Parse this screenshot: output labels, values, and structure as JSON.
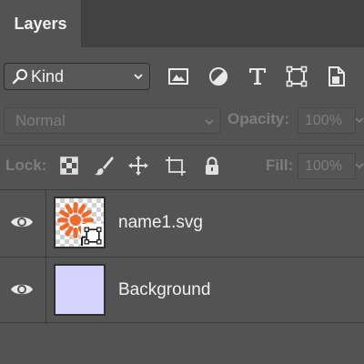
{
  "panel": {
    "tab_title": "Layers"
  },
  "filter": {
    "kind_label": "Kind",
    "icons": [
      "image-filter-icon",
      "adjustment-filter-icon",
      "type-filter-icon",
      "shape-filter-icon",
      "smart-object-filter-icon"
    ]
  },
  "blend": {
    "mode_label": "Normal",
    "opacity_label": "Opacity:",
    "opacity_value": "100%"
  },
  "lock": {
    "lock_label": "Lock:",
    "icons": [
      "lock-transparent-pixels-icon",
      "lock-image-pixels-icon",
      "lock-position-icon",
      "lock-artboard-icon",
      "lock-all-icon"
    ],
    "fill_label": "Fill:",
    "fill_value": "100%"
  },
  "layers": [
    {
      "name": "name1.svg",
      "visible": true,
      "type": "smart-object",
      "thumb_color": "#ef6a2c"
    },
    {
      "name": "Background",
      "visible": true,
      "type": "fill",
      "thumb_color": "#d6d2fe"
    }
  ],
  "colors": {
    "panel_bg": "#535353",
    "tabbar_bg": "#424242",
    "text": "#f0f0f0",
    "disabled_text": "#7d7d7d"
  }
}
